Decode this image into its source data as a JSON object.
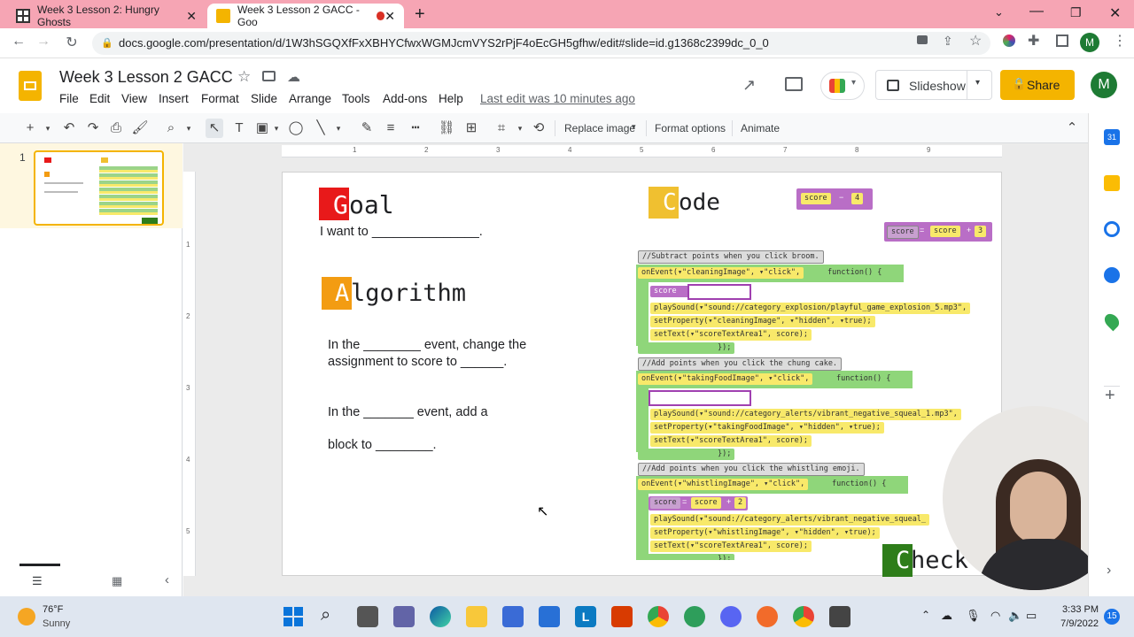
{
  "browser": {
    "tabs": [
      {
        "title": "Week 3 Lesson 2: Hungry Ghosts"
      },
      {
        "title": "Week 3 Lesson 2 GACC - Goo"
      }
    ],
    "url": "docs.google.com/presentation/d/1W3hSGQXfFxXBHYCfwxWGMJcmVYS2rPjF4oEcGH5gfhw/edit#slide=id.g1368c2399dc_0_0",
    "profile_initial": "M"
  },
  "app": {
    "doc_title": "Week 3 Lesson 2 GACC",
    "menus": [
      "File",
      "Edit",
      "View",
      "Insert",
      "Format",
      "Slide",
      "Arrange",
      "Tools",
      "Add-ons",
      "Help"
    ],
    "last_edit": "Last edit was 10 minutes ago",
    "slideshow_label": "Slideshow",
    "share_label": "Share",
    "user_initial": "M"
  },
  "toolbar": {
    "replace_image": "Replace image",
    "format_options": "Format options",
    "animate": "Animate"
  },
  "filmstrip": {
    "slide_number": "1"
  },
  "ruler": {
    "marks": [
      "1",
      "2",
      "3",
      "4",
      "5",
      "6",
      "7",
      "8",
      "9"
    ],
    "vmarks": [
      "1",
      "2",
      "3",
      "4",
      "5"
    ]
  },
  "slide": {
    "goal_letter": "G",
    "goal_rest": "oal",
    "goal_text": "I want to _______________.",
    "code_letter": "C",
    "code_rest": "ode",
    "algo_letter": "A",
    "algo_rest": "lgorithm",
    "algo_line1": "In the ________ event, change the",
    "algo_line2": "assignment to score to ______.",
    "algo_line3": "In the _______ event, add a",
    "algo_line4": "block to ________.",
    "check_letter": "C",
    "check_rest": "heck",
    "snippets": {
      "s1_var": "score",
      "s1_op": "−",
      "s1_val": "4",
      "s2_var": "score",
      "s2_eq": "=",
      "s2_var2": "score",
      "s2_op": "+",
      "s2_val": "3"
    },
    "code": {
      "c1": "//Subtract points when you click broom.",
      "e1": "onEvent(▾\"cleaningImage\", ▾\"click\",",
      "f1": "function() {",
      "a1": "score",
      "p1": "playSound(▾\"sound://category_explosion/playful_game_explosion_5.mp3\",",
      "sp1": "setProperty(▾\"cleaningImage\", ▾\"hidden\", ▾true);",
      "st1": "setText(▾\"scoreTextArea1\", score);",
      "end1": "});",
      "c2": "//Add points when you click the chung cake.",
      "e2": "onEvent(▾\"takingFoodImage\", ▾\"click\",",
      "f2": "function() {",
      "p2": "playSound(▾\"sound://category_alerts/vibrant_negative_squeal_1.mp3\",",
      "sp2": "setProperty(▾\"takingFoodImage\", ▾\"hidden\", ▾true);",
      "st2": "setText(▾\"scoreTextArea1\", score);",
      "end2": "});",
      "c3": "//Add points when you click the whistling emoji.",
      "e3": "onEvent(▾\"whistlingImage\", ▾\"click\",",
      "f3": "function() {",
      "a3": "score",
      "a3eq": "=",
      "a3b": "score",
      "a3op": "+",
      "a3val": "2",
      "p3": "playSound(▾\"sound://category_alerts/vibrant_negative_squeal_",
      "sp3": "setProperty(▾\"whistlingImage\", ▾\"hidden\", ▾true);",
      "st3": "setText(▾\"scoreTextArea1\", score);",
      "end3": "});"
    }
  },
  "taskbar": {
    "temp": "76°F",
    "weather": "Sunny",
    "time": "3:33 PM",
    "date": "7/9/2022",
    "notif_count": "15"
  },
  "colors": {
    "red": "#e8191a",
    "orange": "#f39c12",
    "gold": "#f0c030",
    "green": "#2e7d1a"
  }
}
